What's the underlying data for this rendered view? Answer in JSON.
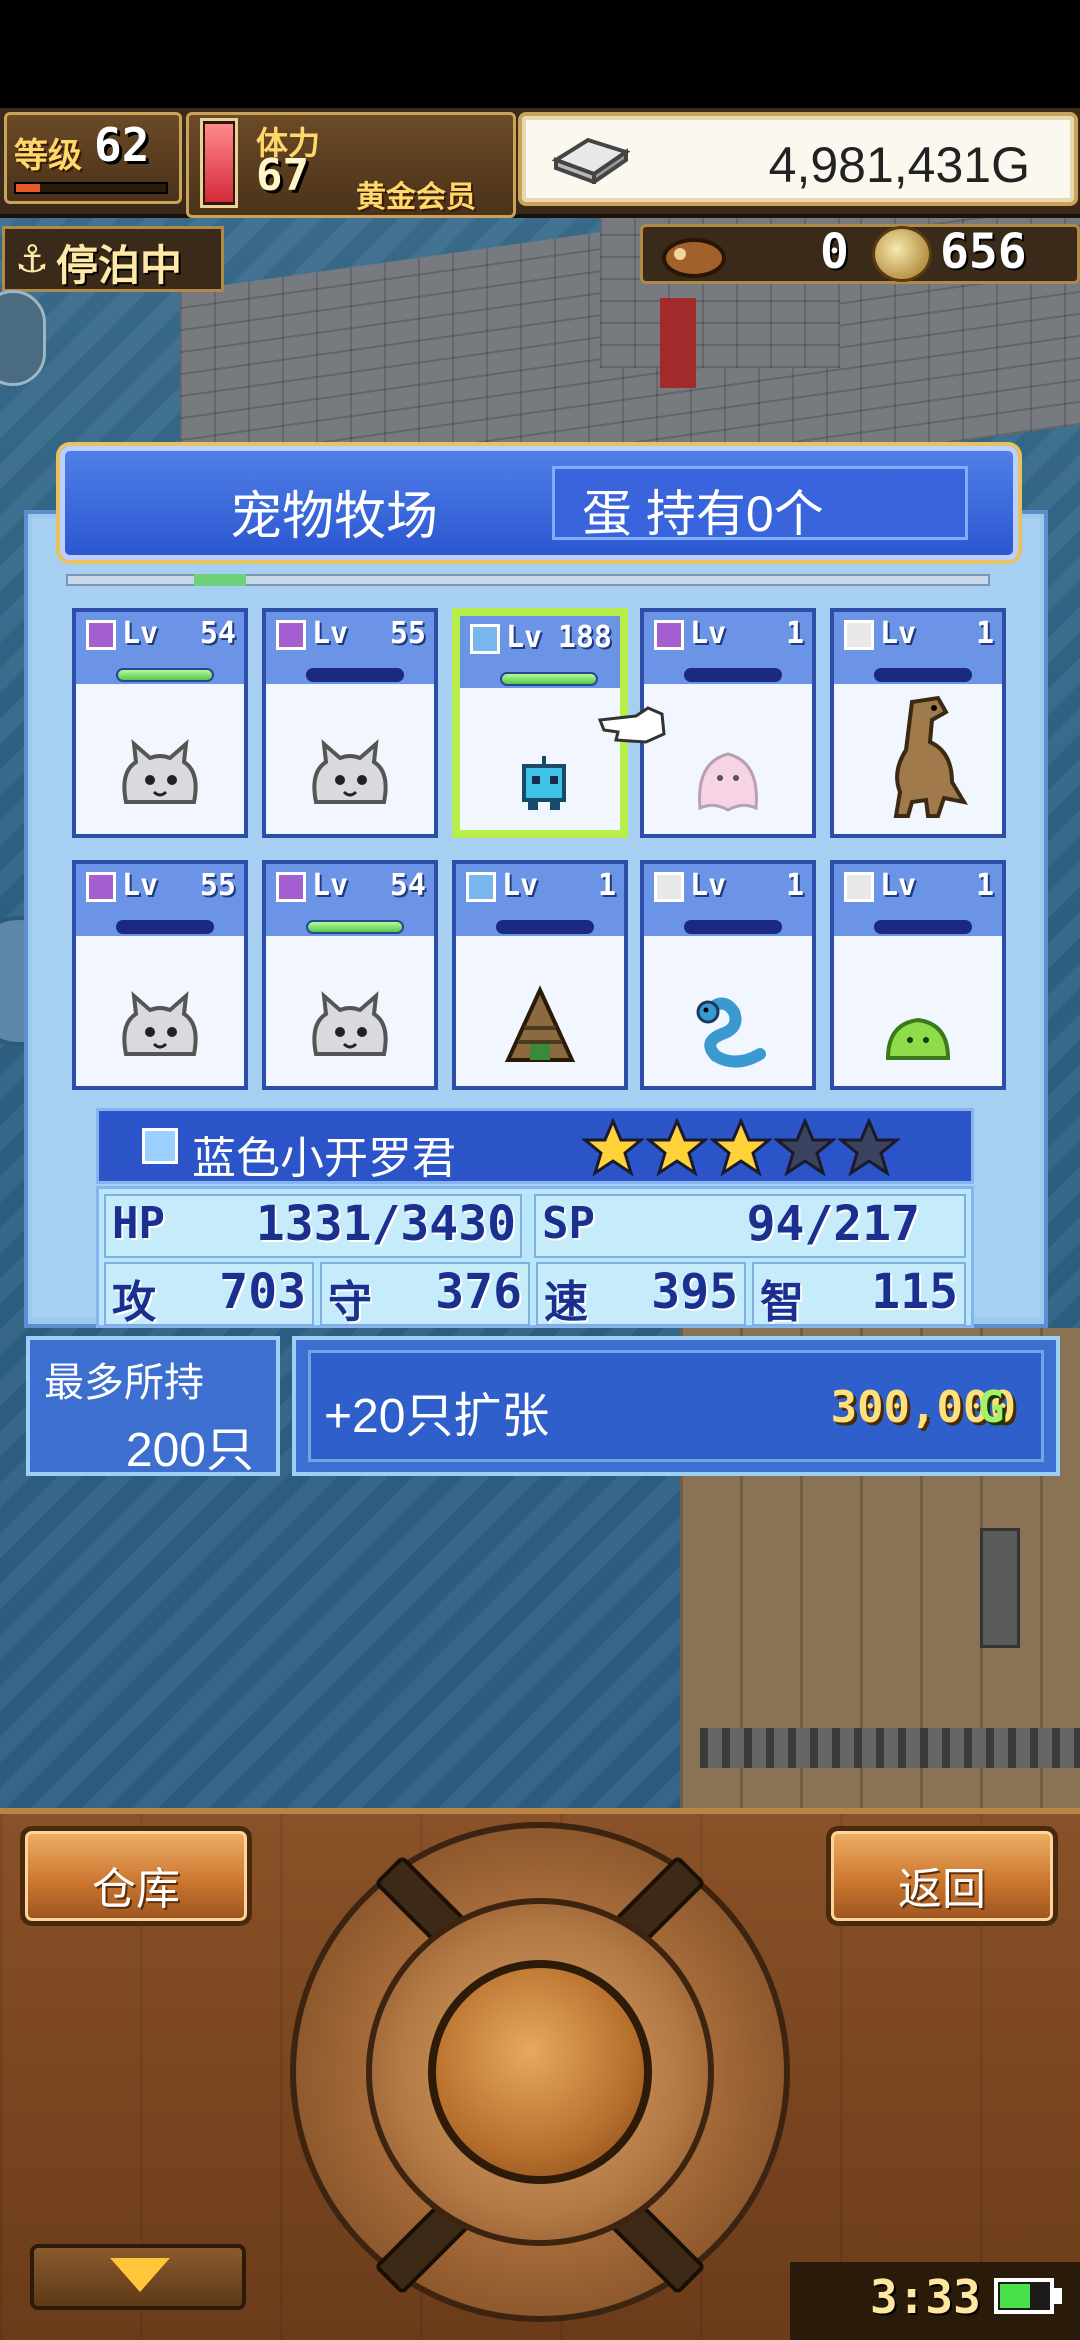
{
  "hud": {
    "level_label": "等级",
    "level_value": "62",
    "stamina_label": "体力",
    "stamina_value": "67",
    "member_label": "黄金会员",
    "gold_value": "4,981,431G",
    "location_status": "停泊中",
    "resource_count_1": "0",
    "resource_count_2": "656",
    "icons": {
      "anchor": "anchor-icon",
      "gold": "silver-bar-icon",
      "item": "bag-icon",
      "coin": "coin-icon"
    }
  },
  "panel": {
    "title": "宠物牧场",
    "eggs_text": "蛋 持有0个"
  },
  "pets": [
    {
      "element": "purple",
      "lv_label": "Lv",
      "level": "54",
      "bar": "green",
      "sprite": "gray-cat"
    },
    {
      "element": "purple",
      "lv_label": "Lv",
      "level": "55",
      "bar": "blue",
      "sprite": "gray-cat"
    },
    {
      "element": "water",
      "lv_label": "Lv",
      "level": "188",
      "bar": "green",
      "sprite": "blue-robot",
      "selected": true
    },
    {
      "element": "purple",
      "lv_label": "Lv",
      "level": "1",
      "bar": "blue",
      "sprite": "pink-ghost"
    },
    {
      "element": "white",
      "lv_label": "Lv",
      "level": "1",
      "bar": "blue",
      "sprite": "dinosaur"
    },
    {
      "element": "purple",
      "lv_label": "Lv",
      "level": "55",
      "bar": "blue",
      "sprite": "gray-cat"
    },
    {
      "element": "purple",
      "lv_label": "Lv",
      "level": "54",
      "bar": "green",
      "sprite": "gray-cat"
    },
    {
      "element": "water",
      "lv_label": "Lv",
      "level": "1",
      "bar": "blue",
      "sprite": "shell-monster"
    },
    {
      "element": "white",
      "lv_label": "Lv",
      "level": "1",
      "bar": "blue",
      "sprite": "blue-snake"
    },
    {
      "element": "white",
      "lv_label": "Lv",
      "level": "1",
      "bar": "blue",
      "sprite": "green-slime"
    }
  ],
  "selected_pet": {
    "name": "蓝色小开罗君",
    "stars_filled": 3,
    "stars_total": 5,
    "hp_label": "HP",
    "hp_value": "1331/3430",
    "sp_label": "SP",
    "sp_value": "94/217",
    "atk_label": "攻",
    "atk_value": "703",
    "def_label": "守",
    "def_value": "376",
    "spd_label": "速",
    "spd_value": "395",
    "int_label": "智",
    "int_value": "115"
  },
  "capacity": {
    "label": "最多所持",
    "value": "200只"
  },
  "expand": {
    "label": "+20只扩张",
    "cost": "300,000",
    "currency": "G"
  },
  "console": {
    "warehouse_label": "仓库",
    "back_label": "返回"
  },
  "clock": "3:33",
  "colors": {
    "panel_blue": "#2c57d0",
    "selection_green": "#b7ee4a",
    "star_gold": "#ffd23a",
    "wood": "#7a4620"
  }
}
